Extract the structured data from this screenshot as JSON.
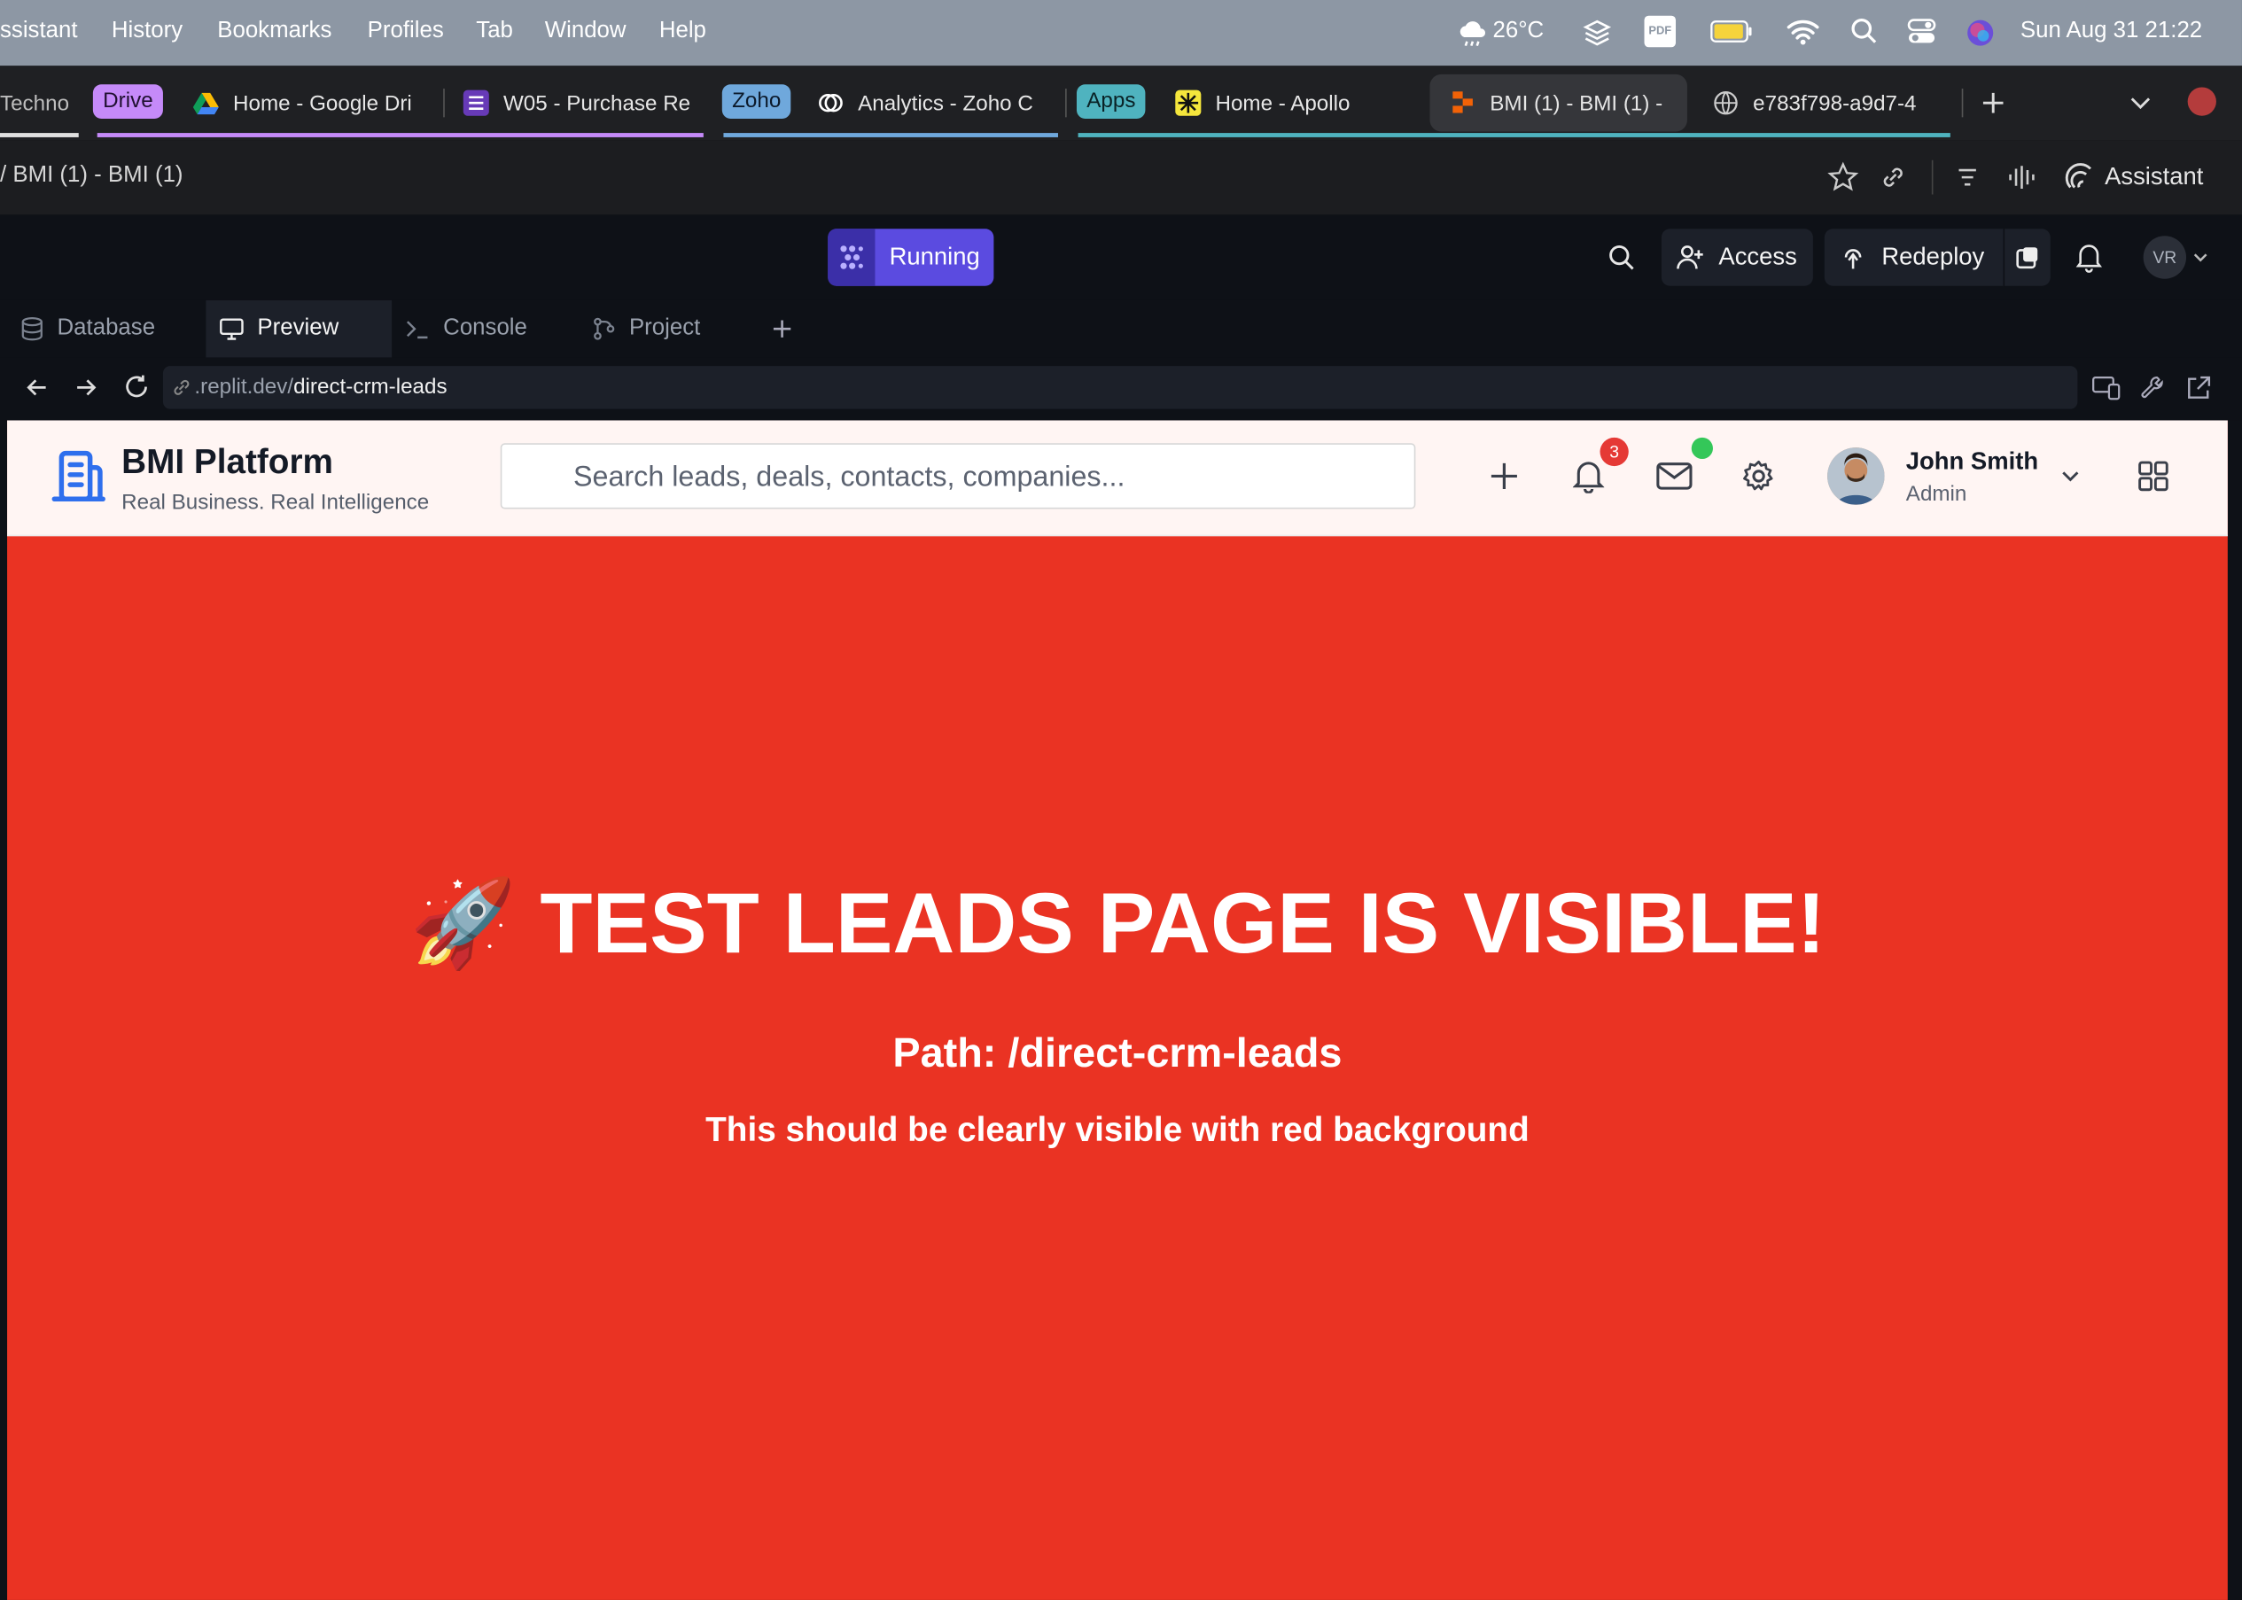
{
  "menubar": {
    "items": [
      "ssistant",
      "History",
      "Bookmarks",
      "Profiles",
      "Tab",
      "Window",
      "Help"
    ],
    "weather": "26°C",
    "pdf_label": "PDF",
    "datetime": "Sun Aug 31  21:22"
  },
  "tabs": {
    "first_tab_label": "Techno",
    "groups": [
      {
        "label": "Drive",
        "color": "#c58af9"
      },
      {
        "label": "Zoho",
        "color": "#6fa8dc"
      },
      {
        "label": "Apps",
        "color": "#4fb3bf"
      }
    ],
    "items": [
      {
        "label": "Home - Google Dri"
      },
      {
        "label": "W05 - Purchase Re"
      },
      {
        "label": "Analytics - Zoho C"
      },
      {
        "label": "Home - Apollo"
      },
      {
        "label": "BMI (1) - BMI (1) -"
      },
      {
        "label": "e783f798-a9d7-4"
      }
    ]
  },
  "address": {
    "title": "/ BMI (1) - BMI (1)",
    "assistant_label": "Assistant"
  },
  "replit": {
    "status_label": "Running",
    "access_label": "Access",
    "redeploy_label": "Redeploy",
    "avatar_initials": "VR",
    "tabs": [
      "Database",
      "Preview",
      "Console",
      "Project"
    ],
    "url_domain": ".replit.dev/",
    "url_path": "direct-crm-leads"
  },
  "app": {
    "brand_title": "BMI Platform",
    "brand_subtitle": "Real Business. Real Intelligence",
    "search_placeholder": "Search leads, deals, contacts, companies...",
    "notification_count": "3",
    "user_name": "John Smith",
    "user_role": "Admin"
  },
  "hero": {
    "emoji": "🚀",
    "headline": "TEST LEADS PAGE IS VISIBLE!",
    "path_line": "Path: /direct-crm-leads",
    "note": "This should be clearly visible with red background"
  },
  "colors": {
    "accent": "#5b4be0",
    "hero_bg": "#ea3323",
    "badge": "#e53935",
    "online": "#34c759"
  }
}
